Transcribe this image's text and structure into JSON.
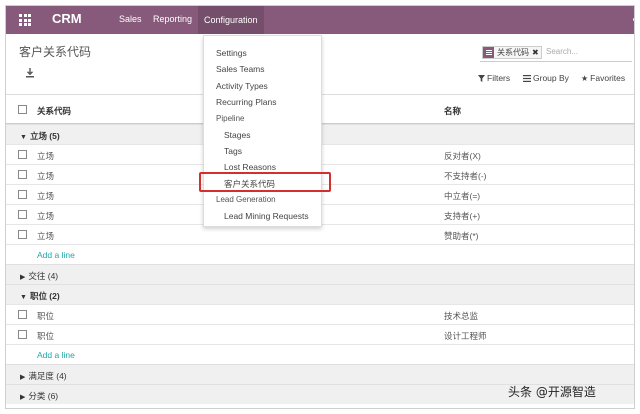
{
  "navbar": {
    "brand": "CRM",
    "menu": [
      "Sales",
      "Reporting",
      "Configuration"
    ]
  },
  "page": {
    "title": "客户关系代码"
  },
  "search": {
    "facet_label": "关系代码",
    "facet_close": "✖",
    "placeholder": "Search..."
  },
  "filters": {
    "filters_label": "Filters",
    "group_by_label": "Group By",
    "favorites_label": "Favorites"
  },
  "table": {
    "columns": [
      "关系代码",
      "名称"
    ],
    "groups": [
      {
        "label": "立场 (5)",
        "expanded": true,
        "rows": [
          {
            "code": "立场",
            "name": "反对者(X)"
          },
          {
            "code": "立场",
            "name": "不支持者(-)"
          },
          {
            "code": "立场",
            "name": "中立者(=)"
          },
          {
            "code": "立场",
            "name": "支持者(+)"
          },
          {
            "code": "立场",
            "name": "赞助者(*)"
          }
        ],
        "add_line": "Add a line"
      },
      {
        "label": "交往 (4)",
        "expanded": false
      },
      {
        "label": "职位 (2)",
        "expanded": true,
        "rows": [
          {
            "code": "职位",
            "name": "技术总监"
          },
          {
            "code": "职位",
            "name": "设计工程师"
          }
        ],
        "add_line": "Add a line"
      },
      {
        "label": "满足度 (4)",
        "expanded": false
      },
      {
        "label": "分类 (6)",
        "expanded": false
      }
    ]
  },
  "dropdown": {
    "items": [
      {
        "label": "Settings",
        "type": "item"
      },
      {
        "label": "Sales Teams",
        "type": "item"
      },
      {
        "label": "Activity Types",
        "type": "item"
      },
      {
        "label": "Recurring Plans",
        "type": "item"
      },
      {
        "label": "Pipeline",
        "type": "header"
      },
      {
        "label": "Stages",
        "type": "subitem"
      },
      {
        "label": "Tags",
        "type": "subitem"
      },
      {
        "label": "Lost Reasons",
        "type": "subitem"
      },
      {
        "label": "客户关系代码",
        "type": "subitem"
      },
      {
        "label": "Lead Generation",
        "type": "header"
      },
      {
        "label": "Lead Mining Requests",
        "type": "subitem"
      }
    ]
  },
  "watermark": "头条 @开源智造",
  "colors": {
    "navbar": "#875a7b",
    "link": "#21a5a8",
    "highlight": "#d32f2f"
  }
}
